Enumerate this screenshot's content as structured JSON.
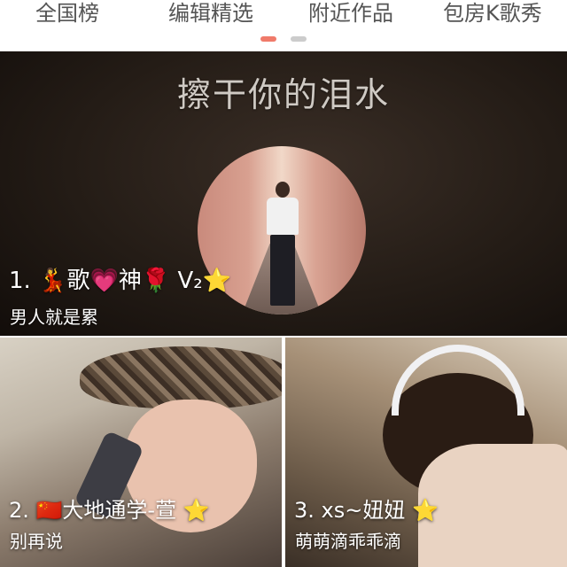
{
  "tabs": [
    {
      "label": "全国榜"
    },
    {
      "label": "编辑精选"
    },
    {
      "label": "附近作品"
    },
    {
      "label": "包房K歌秀"
    }
  ],
  "pager": {
    "active_color": "#f07a6a",
    "inactive_color": "#cccccc"
  },
  "featured": {
    "title": "擦干你的泪水",
    "name": "1. 💃歌💗神🌹 V₂⭐",
    "subtitle": "男人就是累"
  },
  "cards": [
    {
      "name": "2. 🇨🇳大地通学-萱 ⭐",
      "subtitle": "别再说"
    },
    {
      "name": "3. xs~妞妞 ⭐",
      "subtitle": "萌萌滴乖乖滴"
    }
  ]
}
